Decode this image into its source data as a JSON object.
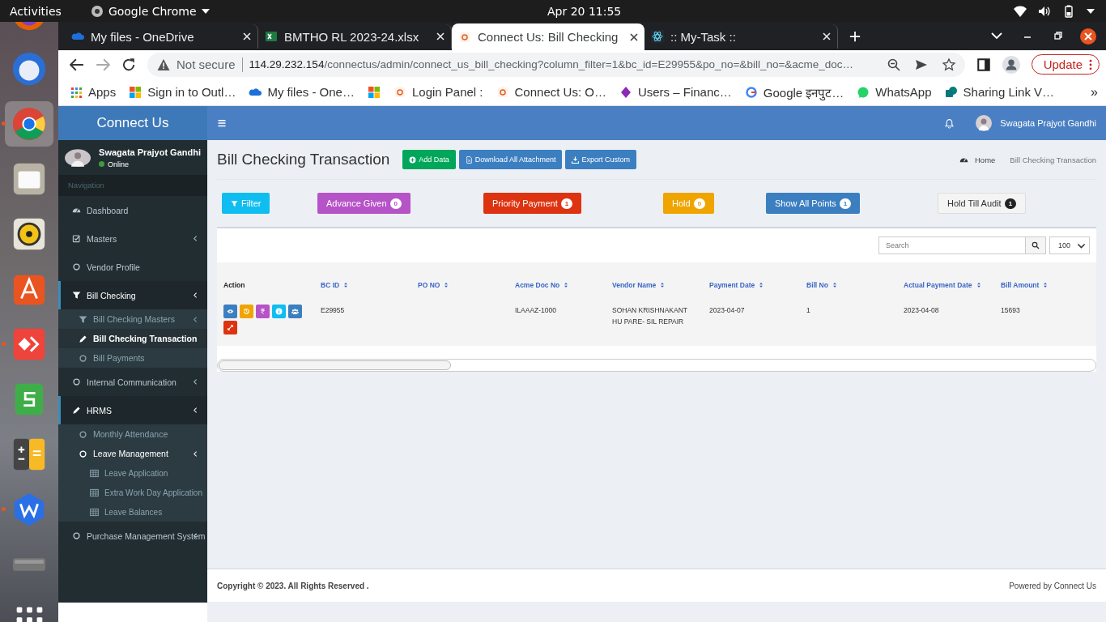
{
  "system_bar": {
    "activities": "Activities",
    "app_name": "Google Chrome",
    "clock": "Apr 20  11:55"
  },
  "dock": [
    {
      "kind": "firefox"
    },
    {
      "kind": "thunderbird",
      "selected": false,
      "running": false
    },
    {
      "kind": "chrome",
      "selected": true,
      "running": true
    },
    {
      "kind": "files",
      "selected": false,
      "running": false
    },
    {
      "kind": "rhythmbox",
      "selected": false,
      "running": false
    },
    {
      "kind": "software",
      "selected": false,
      "running": false
    },
    {
      "kind": "anydesk",
      "selected": false,
      "running": true
    },
    {
      "kind": "sheets",
      "selected": false,
      "running": false
    },
    {
      "kind": "calculator",
      "selected": false,
      "running": false
    },
    {
      "kind": "wps",
      "selected": false,
      "running": true
    },
    {
      "kind": "drive",
      "selected": false,
      "running": false
    },
    {
      "kind": "apps",
      "selected": false,
      "running": false
    }
  ],
  "browser": {
    "tabs": [
      {
        "title": "My files - OneDrive",
        "kind": "cloud",
        "selected": false
      },
      {
        "title": "BMTHO RL 2023-24.xlsx",
        "kind": "sheet",
        "selected": false
      },
      {
        "title": "Connect Us: Bill Checking",
        "kind": "logo",
        "selected": true
      },
      {
        "title": ":: My-Task ::",
        "kind": "atom",
        "selected": false
      }
    ],
    "address": {
      "security": "Not secure",
      "host": "114.29.232.154",
      "path": "/connectus/admin/connect_us_bill_checking?column_filter=1&bc_id=E29955&po_no=&bill_no=&acme_doc…"
    },
    "update": "Update",
    "bookmarks": [
      {
        "kind": "grid",
        "label": "Apps"
      },
      {
        "kind": "squares",
        "label": "Sign in to Outl…"
      },
      {
        "kind": "cloud",
        "label": "My files - One…"
      },
      {
        "kind": "squares"
      },
      {
        "kind": "logo",
        "label": "Login Panel :"
      },
      {
        "kind": "logo",
        "label": "Connect Us: O…"
      },
      {
        "kind": "diamond",
        "label": "Users – Financ…"
      },
      {
        "kind": "ring",
        "label": "Google इनपुट…"
      },
      {
        "kind": "bubble",
        "label": "WhatsApp"
      },
      {
        "kind": "tile",
        "label": "Sharing Link V…"
      }
    ],
    "bookmarks_more": "»"
  },
  "app": {
    "brand": "Connect Us",
    "header_user": "Swagata Prajyot Gandhi",
    "sidebar": {
      "user": "Swagata Prajyot Gandhi",
      "status": "Online",
      "heading": "Navigation",
      "menu": [
        {
          "label": "Dashboard",
          "kind": "gauge",
          "selected": false
        },
        {
          "label": "Masters",
          "kind": "check",
          "selected": false,
          "open": false
        },
        {
          "label": "Vendor Profile",
          "kind": "circle",
          "selected": false
        },
        {
          "label": "Bill Checking",
          "kind": "filter",
          "selected": false,
          "open": true,
          "children": [
            {
              "label": "Bill Checking Masters",
              "kind": "filter",
              "selected": false,
              "open": false
            },
            {
              "label": "Bill Checking Transaction",
              "kind": "pencil",
              "selected": true
            },
            {
              "label": "Bill Payments",
              "kind": "circle",
              "selected": false
            }
          ]
        },
        {
          "label": "Internal Communication",
          "kind": "circle",
          "selected": false,
          "open": false
        },
        {
          "label": "HRMS",
          "kind": "pencil",
          "selected": false,
          "open": true,
          "children": [
            {
              "label": "Monthly Attendance",
              "kind": "circle",
              "selected": false
            },
            {
              "label": "Leave Management",
              "kind": "circle",
              "selected": false,
              "open": true,
              "children": [
                {
                  "label": "Leave Application",
                  "kind": "table",
                  "selected": false
                },
                {
                  "label": "Extra Work Day Application",
                  "kind": "table",
                  "selected": false
                },
                {
                  "label": "Leave Balances",
                  "kind": "table",
                  "selected": false
                }
              ]
            }
          ]
        },
        {
          "label": "Purchase Management System",
          "kind": "circle",
          "selected": false,
          "open": false
        }
      ]
    },
    "page_title": "Bill Checking Transaction",
    "actions": [
      {
        "kind": "success",
        "label": "Add Data"
      },
      {
        "kind": "primary",
        "label": "Download All Attachment"
      },
      {
        "kind": "primary",
        "label": "Export Custom"
      }
    ],
    "breadcrumb": [
      "Home",
      "Bill Checking Transaction"
    ],
    "filters": [
      {
        "kind": "info",
        "label": "Filter"
      },
      {
        "kind": "purple",
        "label": "Advance Given",
        "count": "0"
      },
      {
        "kind": "danger",
        "label": "Priority Payment",
        "count": "1"
      },
      {
        "kind": "warning",
        "label": "Hold",
        "count": "0"
      },
      {
        "kind": "primary",
        "label": "Show All Points",
        "count": "1"
      },
      {
        "kind": "default",
        "label": "Hold Till Audit",
        "count": "1"
      }
    ],
    "table": {
      "search_placeholder": "Search",
      "page_size": "100",
      "columns": [
        {
          "label": "Action",
          "sortable": false
        },
        {
          "label": "BC ID",
          "sortable": true
        },
        {
          "label": "PO NO",
          "sortable": true
        },
        {
          "label": "Acme Doc No",
          "sortable": true
        },
        {
          "label": "Vendor Name",
          "sortable": true
        },
        {
          "label": "Payment Date",
          "sortable": true
        },
        {
          "label": "Bill No",
          "sortable": true
        },
        {
          "label": "Actual Payment Date",
          "sortable": true
        },
        {
          "label": "Bill Amount",
          "sortable": true
        }
      ],
      "rows": [
        {
          "cells": [
            {
              "buttons": [
                {
                  "kind": "view"
                },
                {
                  "kind": "history"
                },
                {
                  "kind": "rupee"
                },
                {
                  "kind": "info"
                },
                {
                  "kind": "users"
                },
                {
                  "kind": "expand"
                }
              ]
            },
            "E29955",
            "",
            "ILAAAZ-1000",
            "SOHAN KRISHNAKANT HU PARE- SIL REPAIR",
            "2023-04-07",
            "1",
            "2023-04-08",
            "15693"
          ]
        }
      ]
    },
    "footer": {
      "copyright": "Copyright © 2023. All Rights Reserved .",
      "powered": "Powered by Connect Us"
    }
  }
}
